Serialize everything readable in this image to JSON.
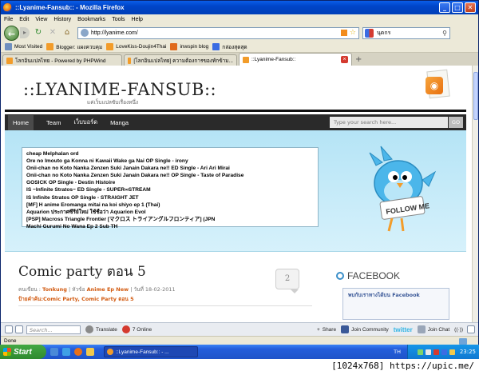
{
  "window": {
    "title": "::Lyanime-Fansub:: - Mozilla Firefox",
    "buttons": {
      "minimize": "_",
      "maximize": "□",
      "close": "✕"
    }
  },
  "menu": [
    "File",
    "Edit",
    "View",
    "History",
    "Bookmarks",
    "Tools",
    "Help"
  ],
  "navbar": {
    "url": "http://lyanime.com/",
    "search_value": "นุดกร"
  },
  "bookmarks": [
    {
      "label": "Most Visited",
      "color": "#6f8fbf"
    },
    {
      "label": "Blogger: แผงควบคุม",
      "color": "#f29c2a"
    },
    {
      "label": "LoveKiss-Doujin4Thai",
      "color": "#f29c2a"
    },
    {
      "label": "inwspin blog",
      "color": "#e06a1c"
    },
    {
      "label": "กล่องสุดสุด",
      "color": "#3b6ce3"
    }
  ],
  "tabs": [
    {
      "label": "โลกอินแปลไทย - Powered by PHPWind"
    },
    {
      "label": "[โลกอินแปลไทย] ความต้องการของทักข้าม..."
    },
    {
      "label": "::Lyanime-Fansub::",
      "active": true
    }
  ],
  "site": {
    "logo": "::LYANIME-FANSUB::",
    "tagline": "แค่เว็บแปลซับเรื่องหนึ่ง",
    "nav": [
      "Home",
      "Team",
      "เว็บบอร์ด",
      "Manga"
    ],
    "search_placeholder": "Type your search here...",
    "search_button": "GO",
    "ticker": [
      "cheap Melphalan ord",
      "Ore no Imouto ga Konna ni Kawaii Wake ga Nai OP Single - irony",
      "Onii-chan no Koto Nanka Zenzen Suki Janain Dakara ne!! ED Single - Ari Ari Mirai",
      "Onii-chan no Koto Nanka Zenzen Suki Janain Dakara ne!! OP Single - Taste of Paradise",
      "GOSICK OP Single - Destin Histoire",
      "IS ~Infinite Stratos~ ED Single - SUPER∞STREAM",
      "IS Infinite Stratos OP Single - STRAIGHT JET",
      "[MF] H anime Eromanga mitai na koi shiyo ep 1 (Thai)",
      "Aquarion ประกาศซีรีย์ใหม่ ใช้ชื่อว่า Aquarion Evol",
      "[PSP] Macross Triangle Frontier [マクロス トライアングルフロンティア] (JPN",
      "Machi Gurumi No Wana Ep 2 Sub TH"
    ],
    "follow_me": "FOLLOW ME",
    "post": {
      "title": "Comic party ตอน 5",
      "meta_prefix": "คนเขียน : ",
      "author": "Tonkung",
      "meta_sep1": " | หัวข้อ ",
      "category": "Anime Ep New",
      "meta_date": " | วันที่ 18-02-2011",
      "tags_prefix": "ป้ายคำค้น:",
      "tags": "Comic Party, Comic Party ตอน 5",
      "comments": "2"
    },
    "facebook": {
      "title": "FACEBOOK",
      "box_text": "พบกับเราทางได้บน Facebook"
    }
  },
  "bottombar": {
    "search_placeholder": "Search...",
    "translate": "Translate",
    "online": "7 Online",
    "share": "Share",
    "join_community": "Join Community",
    "twitter": "twitter",
    "join_chat": "Join Chat"
  },
  "status": "Done",
  "taskbar": {
    "start": "Start",
    "task": "::Lyanime-Fansub:: - ...",
    "lang": "TH",
    "clock": "23:25"
  },
  "caption": "[1024x768] https://upic.me/"
}
